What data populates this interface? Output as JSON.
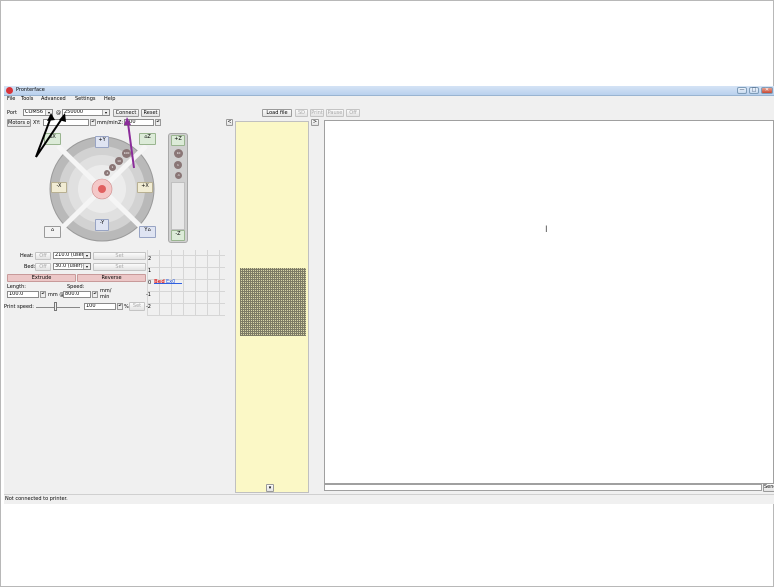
{
  "app": {
    "title": "Pronterface"
  },
  "window_controls": {
    "minimize": "—",
    "maximize": "□",
    "close": "✕"
  },
  "menu": {
    "file": "File",
    "tools": "Tools",
    "advanced": "Advanced",
    "settings": "Settings",
    "help": "Help"
  },
  "connection": {
    "port_label": "Port",
    "port_value": "COM56",
    "baud_prefix": "@",
    "baud_value": "250000",
    "connect_label": "Connect",
    "reset_label": "Reset"
  },
  "toolbar": {
    "load_file": "Load file",
    "sd": "SD",
    "print": "Print",
    "pause": "Pause",
    "off": "Off"
  },
  "motors": {
    "motors_off": "Motors off",
    "xy_label": "XY:",
    "xy_unit": "mm/min",
    "z_label": "Z:",
    "z_value": "100"
  },
  "jog": {
    "home_x": "X",
    "home_y": "Y",
    "home_z": "Z",
    "home_all": "⌂",
    "plus_x": "+X",
    "minus_x": "-X",
    "plus_y": "+Y",
    "minus_y": "-Y",
    "plus_z": "+Z",
    "minus_z": "-Z",
    "step_100": "100",
    "step_10": "10",
    "step_1": "1",
    "step_01": ".1",
    "z_step_10": "10",
    "z_step_1": "1",
    "z_step_01": ".1",
    "center": "⊕"
  },
  "temps": {
    "heat_label": "Heat:",
    "heat_off": "Off",
    "heat_value": "210.0 (user",
    "heat_set": "Set",
    "bed_label": "Bed:",
    "bed_off": "Off",
    "bed_value": "30.0 (user)",
    "bed_set": "Set"
  },
  "graph": {
    "ticks": [
      "2",
      "1",
      "0",
      "-1",
      "-2"
    ],
    "legend_bed": "Bed",
    "legend_ext": "Ex0"
  },
  "extrude": {
    "extrude_label": "Extrude",
    "reverse_label": "Reverse",
    "length_label": "Length:",
    "speed_label": "Speed:",
    "length_value": "100.0",
    "length_unit": "mm @",
    "speed_value": "800.0",
    "speed_unit_top": "mm/",
    "speed_unit_bottom": "min"
  },
  "print_speed": {
    "label": "Print speed:",
    "value": "100",
    "percent": "%",
    "set": "Set"
  },
  "plater": {
    "collapse_left": "<",
    "collapse_right": ">",
    "scroll_down": "▾"
  },
  "console": {
    "cursor": "I",
    "send_label": "Send"
  },
  "status": {
    "text": "Not connected to printer."
  },
  "colors": {
    "accent_arrow_purple": "#8b2c9a",
    "bed_legend": "#e03030",
    "ext_legend": "#3060e0"
  }
}
